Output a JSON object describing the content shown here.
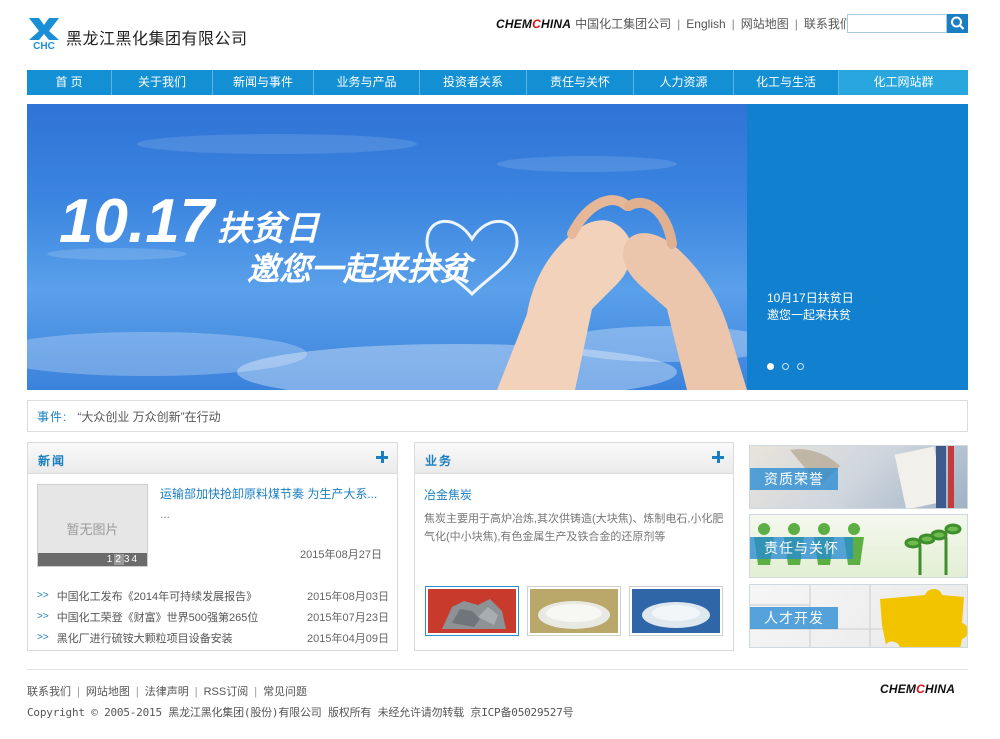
{
  "header": {
    "company_name": "黑龙江黑化集团有限公司",
    "logo_text": "CHC",
    "brand_prefix": "CHEM",
    "brand_mid": "C",
    "brand_suffix": "HINA",
    "parent_company": "中国化工集团公司",
    "links": [
      "English",
      "网站地图",
      "联系我们"
    ],
    "search_value": ""
  },
  "nav": {
    "items": [
      "首 页",
      "关于我们",
      "新闻与事件",
      "业务与产品",
      "投资者关系",
      "责任与关怀",
      "人力资源",
      "化工与生活",
      "化工网站群"
    ]
  },
  "banner": {
    "headline_number": "10.17",
    "headline_text": "扶贫日",
    "subline": "邀您一起来扶贫",
    "side_caption_line1": "10月17日扶贫日",
    "side_caption_line2": "邀您一起来扶贫",
    "slide_count": 3,
    "active_slide": 0
  },
  "event": {
    "label": "事件:",
    "text": "“大众创业 万众创新”在行动"
  },
  "news": {
    "title": "新闻",
    "thumb_text": "暂无图片",
    "thumb_pager": [
      "1",
      "2",
      "3",
      "4"
    ],
    "headline": "运输部加快抢卸原料煤节奏 为生产大系...",
    "ellipsis": "...",
    "headline_date": "2015年08月27日",
    "items": [
      {
        "title": "中国化工发布《2014年可持续发展报告》",
        "date": "2015年08月03日"
      },
      {
        "title": "中国化工荣登《财富》世界500强第265位",
        "date": "2015年07月23日"
      },
      {
        "title": "黑化厂进行硫铵大颗粒项目设备安装",
        "date": "2015年04月09日"
      }
    ]
  },
  "business": {
    "title": "业务",
    "item_title": "冶金焦炭",
    "description": "焦炭主要用于高炉冶炼,其次供铸造(大块焦)、炼制电石,小化肥气化(中小块焦),有色金属生产及铁合金的还原剂等"
  },
  "promos": [
    "资质荣誉",
    "责任与关怀",
    "人才开发"
  ],
  "footer": {
    "links": [
      "联系我们",
      "网站地图",
      "法律声明",
      "RSS订阅",
      "常见问题"
    ],
    "copyright": "Copyright © 2005-2015 黑龙江黑化集团(股份)有限公司 版权所有 未经允许请勿转载 京ICP备05029527号"
  },
  "colors": {
    "primary": "#1390d3",
    "accent_text": "#1a7fc1",
    "brand_red": "#d9131b"
  }
}
